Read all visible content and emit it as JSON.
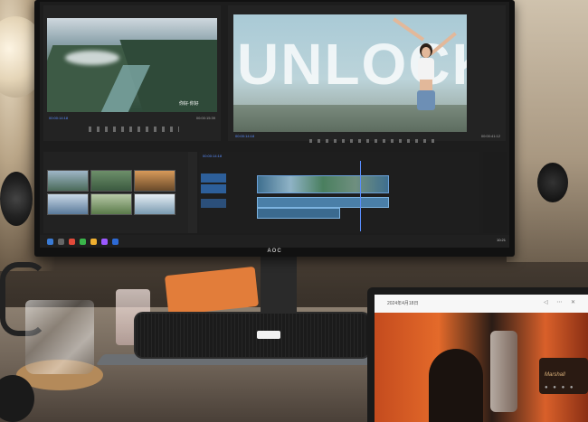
{
  "monitor": {
    "brand": "AOC",
    "source_panel": {
      "subtitle": "你好·你好",
      "timecode_left": "00:00:14:18",
      "timecode_right": "00:00:15:39"
    },
    "program_panel": {
      "overlay_text": "UNLOCK",
      "timecode_left": "00:00:14:18",
      "timecode_right": "00:00:41:12"
    },
    "timeline": {
      "timecode": "00:00:14:18"
    },
    "taskbar": {
      "tray_text": "10:21"
    }
  },
  "tablet": {
    "title": "2024年4月18日",
    "icons": "◁ ⋯ ✕",
    "amp_label": "Marshall",
    "amp_knobs": "● ● ● ●"
  },
  "colors": {
    "accent": "#5a8eff",
    "box": "#e27d3a",
    "tablet_orange": "#e46a2a"
  }
}
